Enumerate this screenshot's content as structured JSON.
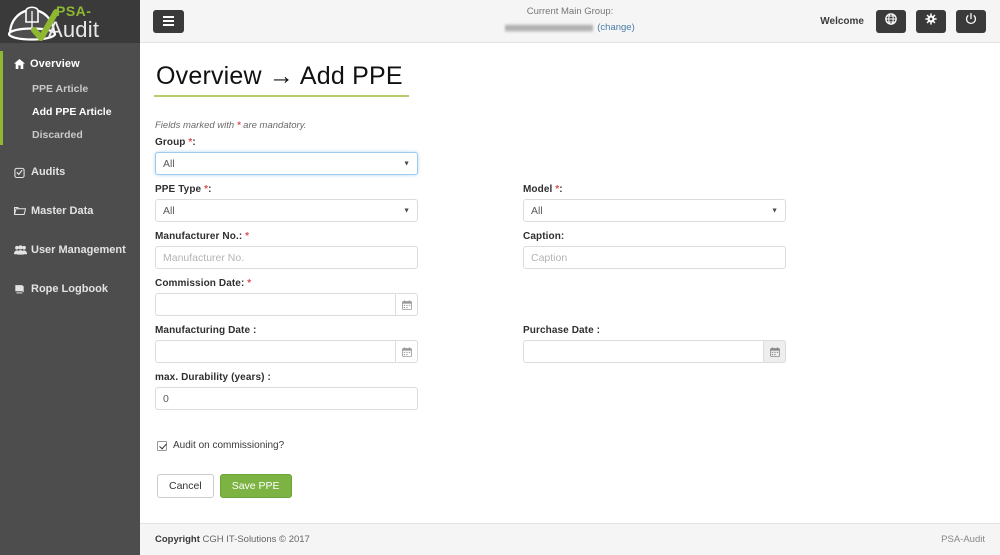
{
  "brand": {
    "name_top": "PSA-",
    "name_bottom": "Audit",
    "accent_green": "#8eb832",
    "sidebar_bg": "#4d4d4d",
    "logo_bg": "#3a3a3a"
  },
  "sidebar": {
    "overview": {
      "label": "Overview",
      "icon": "home-icon",
      "subitems": [
        {
          "label": "PPE Article",
          "active": false
        },
        {
          "label": "Add PPE Article",
          "active": true
        },
        {
          "label": "Discarded",
          "active": false
        }
      ]
    },
    "items": [
      {
        "label": "Audits",
        "icon": "clipboard-check-icon"
      },
      {
        "label": "Master Data",
        "icon": "folder-icon"
      },
      {
        "label": "User Management",
        "icon": "users-icon"
      },
      {
        "label": "Rope Logbook",
        "icon": "book-icon"
      }
    ]
  },
  "topbar": {
    "menu_toggle": "hamburger-icon",
    "group_label": "Current Main Group:",
    "group_value": "",
    "group_value_redacted": true,
    "change_link": "(change)",
    "welcome": "Welcome",
    "buttons": [
      {
        "name": "globe-icon",
        "title": "Language"
      },
      {
        "name": "gear-icon",
        "title": "Settings"
      },
      {
        "name": "power-icon",
        "title": "Logout"
      }
    ]
  },
  "page": {
    "title": "Overview → Add PPE",
    "title_underline_color": "#b7cd6a",
    "mandatory_note_pre": "Fields marked with ",
    "mandatory_note_star": "*",
    "mandatory_note_post": " are mandatory."
  },
  "form": {
    "group": {
      "label": "Group ",
      "required": "*",
      "label_suffix": ":",
      "value": "All",
      "type": "select",
      "focused": true
    },
    "ppe_type": {
      "label": "PPE Type ",
      "required": "*",
      "label_suffix": ":",
      "value": "All",
      "type": "select",
      "focused": false
    },
    "model": {
      "label": "Model ",
      "required": "*",
      "label_suffix": ":",
      "value": "All",
      "type": "select",
      "focused": false
    },
    "manufacturer_no": {
      "label": "Manufacturer No.: ",
      "required": "*",
      "label_suffix": "",
      "value": "",
      "placeholder": "Manufacturer No.",
      "type": "text"
    },
    "caption": {
      "label": "Caption:",
      "required": "",
      "label_suffix": "",
      "value": "",
      "placeholder": "Caption",
      "type": "text"
    },
    "commission_date": {
      "label": "Commission Date: ",
      "required": "*",
      "label_suffix": "",
      "value": "",
      "placeholder": "",
      "type": "date",
      "button_icon": "calendar-icon",
      "button_grey": false
    },
    "manufacturing_date": {
      "label": "Manufacturing Date :",
      "required": "",
      "label_suffix": "",
      "value": "",
      "placeholder": "",
      "type": "date",
      "button_icon": "calendar-icon",
      "button_grey": false
    },
    "purchase_date": {
      "label": "Purchase Date :",
      "required": "",
      "label_suffix": "",
      "value": "",
      "placeholder": "",
      "type": "date",
      "button_icon": "calendar-icon",
      "button_grey": true
    },
    "durability": {
      "label": "max. Durability (years) :",
      "required": "",
      "label_suffix": "",
      "value": "0",
      "placeholder": "",
      "type": "number"
    },
    "audit_on_commissioning": {
      "label": "Audit on commissioning?",
      "checked": true
    },
    "cancel_button": "Cancel",
    "save_button": "Save PPE",
    "save_button_color": "#7cb342"
  },
  "footer": {
    "copyright_bold": "Copyright",
    "copyright_text": " CGH IT-Solutions © 2017",
    "right": "PSA-Audit"
  }
}
